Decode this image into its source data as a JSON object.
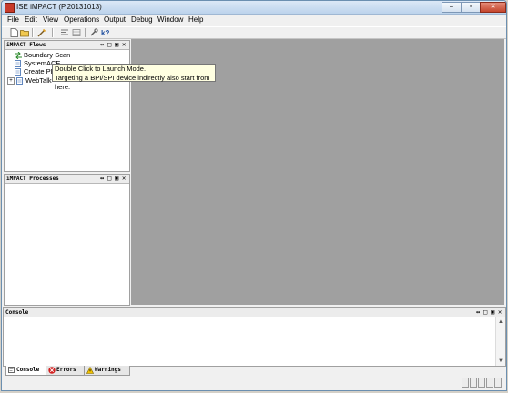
{
  "window": {
    "title": "ISE iMPACT (P.20131013)"
  },
  "menu": [
    "File",
    "Edit",
    "View",
    "Operations",
    "Output",
    "Debug",
    "Window",
    "Help"
  ],
  "flows_panel": {
    "title": "iMPACT Flows",
    "items": [
      {
        "label": "Boundary Scan",
        "icon": "boundary-scan-icon"
      },
      {
        "label": "SystemACE",
        "icon": "document-icon"
      },
      {
        "label": "Create PROM File (PROM File Formatter)",
        "visible_label": "Create PR",
        "icon": "document-icon"
      },
      {
        "label": "WebTalk Data",
        "visible_label": "WebTalk",
        "icon": "document-icon"
      }
    ]
  },
  "tooltip": {
    "line1": "Double Click to Launch Mode.",
    "line2": "Targeting a BPI/SPI device indirectly also start from here."
  },
  "processes_panel": {
    "title": "iMPACT Processes"
  },
  "console_panel": {
    "title": "Console"
  },
  "bottom_tabs": [
    {
      "label": "Console",
      "icon": "console-icon",
      "active": true
    },
    {
      "label": "Errors",
      "icon": "error-icon",
      "active": false
    },
    {
      "label": "Warnings",
      "icon": "warning-icon",
      "active": false
    }
  ],
  "colors": {
    "workspace": "#a0a0a0",
    "tooltip_bg": "#ffffe1",
    "error_red": "#d32020",
    "warning_yellow": "#f2c200"
  }
}
